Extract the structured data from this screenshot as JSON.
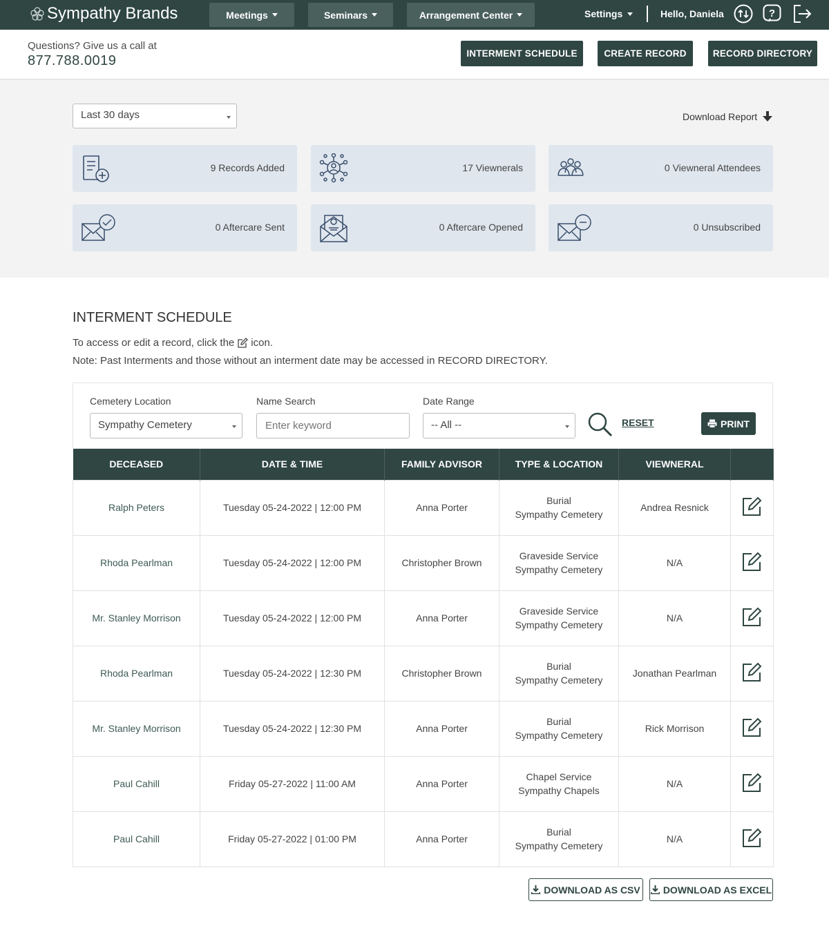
{
  "nav": {
    "brand": "Sympathy Brands",
    "menus": [
      {
        "label": "Meetings"
      },
      {
        "label": "Seminars"
      },
      {
        "label": "Arrangement Center"
      }
    ],
    "settings_label": "Settings",
    "greeting": "Hello, Daniela",
    "icons": [
      "sync-icon",
      "help-icon",
      "logout-icon"
    ]
  },
  "header": {
    "questions": "Questions? Give us a call at",
    "phone": "877.788.0019",
    "buttons": [
      "INTERMENT SCHEDULE",
      "CREATE RECORD",
      "RECORD DIRECTORY"
    ]
  },
  "stats": {
    "range_selected": "Last 30 days",
    "download_report": "Download Report",
    "cards": [
      {
        "icon": "record-add-icon",
        "label": "9 Records Added"
      },
      {
        "icon": "network-people-icon",
        "label": "17 Viewnerals"
      },
      {
        "icon": "group-icon",
        "label": "0 Viewneral Attendees"
      },
      {
        "icon": "mail-check-icon",
        "label": "0 Aftercare Sent"
      },
      {
        "icon": "mail-open-icon",
        "label": "0 Aftercare Opened"
      },
      {
        "icon": "mail-minus-icon",
        "label": "0 Unsubscribed"
      }
    ]
  },
  "schedule": {
    "title": "INTERMENT SCHEDULE",
    "note1_before": "To access or edit a record, click the",
    "note1_after": "icon.",
    "note2": "Note: Past Interments and those without an interment date may be accessed in RECORD DIRECTORY.",
    "filters": {
      "cemetery_label": "Cemetery Location",
      "cemetery_value": "Sympathy Cemetery",
      "name_label": "Name Search",
      "name_placeholder": "Enter keyword",
      "date_label": "Date Range",
      "date_value": "-- All --",
      "reset": "RESET",
      "print": "PRINT"
    },
    "columns": [
      "DECEASED",
      "DATE & TIME",
      "FAMILY ADVISOR",
      "TYPE & LOCATION",
      "VIEWNERAL",
      ""
    ],
    "rows": [
      {
        "deceased": "Ralph Peters",
        "datetime": "Tuesday 05-24-2022 | 12:00 PM",
        "advisor": "Anna Porter",
        "type": "Burial",
        "location": "Sympathy Cemetery",
        "viewneral": "Andrea Resnick"
      },
      {
        "deceased": "Rhoda Pearlman",
        "datetime": "Tuesday 05-24-2022 | 12:00 PM",
        "advisor": "Christopher Brown",
        "type": "Graveside Service",
        "location": "Sympathy Cemetery",
        "viewneral": "N/A"
      },
      {
        "deceased": "Mr. Stanley Morrison",
        "datetime": "Tuesday 05-24-2022 | 12:00 PM",
        "advisor": "Anna Porter",
        "type": "Graveside Service",
        "location": "Sympathy Cemetery",
        "viewneral": "N/A"
      },
      {
        "deceased": "Rhoda Pearlman",
        "datetime": "Tuesday 05-24-2022 | 12:30 PM",
        "advisor": "Christopher Brown",
        "type": "Burial",
        "location": "Sympathy Cemetery",
        "viewneral": "Jonathan Pearlman"
      },
      {
        "deceased": "Mr. Stanley Morrison",
        "datetime": "Tuesday 05-24-2022 | 12:30 PM",
        "advisor": "Anna Porter",
        "type": "Burial",
        "location": "Sympathy Cemetery",
        "viewneral": "Rick Morrison"
      },
      {
        "deceased": "Paul Cahill",
        "datetime": "Friday 05-27-2022 | 11:00 AM",
        "advisor": "Anna Porter",
        "type": "Chapel Service",
        "location": "Sympathy Chapels",
        "viewneral": "N/A"
      },
      {
        "deceased": "Paul Cahill",
        "datetime": "Friday 05-27-2022 | 01:00 PM",
        "advisor": "Anna Porter",
        "type": "Burial",
        "location": "Sympathy Cemetery",
        "viewneral": "N/A"
      }
    ],
    "download_csv": "DOWNLOAD AS CSV",
    "download_excel": "DOWNLOAD AS EXCEL"
  },
  "colors": {
    "primary": "#2f4642",
    "nav_button": "#4a605c",
    "card_bg": "#dfe6ee",
    "section_bg": "#f3f3f3"
  }
}
